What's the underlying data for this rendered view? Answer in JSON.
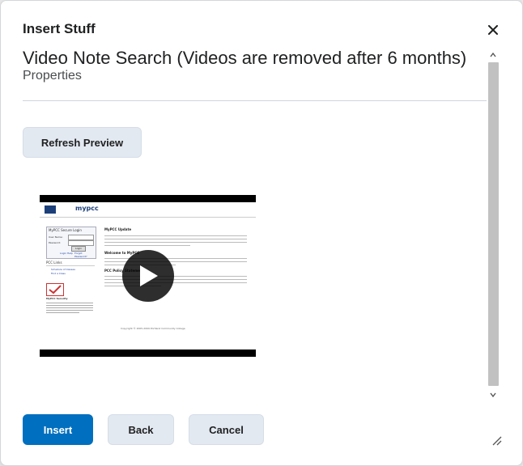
{
  "dialog": {
    "title": "Insert Stuff",
    "close_icon": "close-icon"
  },
  "content": {
    "heading": "Video Note Search (Videos are removed after 6 months)",
    "subheading": "Properties",
    "refresh_label": "Refresh Preview"
  },
  "video": {
    "thumbnail": {
      "logo_text": "mypcc",
      "login_title": "MyPCC Secure Login",
      "user_label": "User Name:",
      "pass_label": "Password:",
      "login_button": "Login",
      "help_links": [
        "Login Help",
        "Forgot Password?"
      ],
      "pcc_links_title": "PCC Links",
      "pcc_links": [
        "Schedule of Classes",
        "Find a Class"
      ],
      "update_title": "MyPCC Update",
      "welcome_title": "Welcome to MyPCC",
      "policy_title": "PCC Policy Statement",
      "security_title": "MyPCC Security",
      "footer": "Copyright © 2005-2009 Portland Community College"
    },
    "play_icon": "play-icon"
  },
  "footer": {
    "insert_label": "Insert",
    "back_label": "Back",
    "cancel_label": "Cancel"
  },
  "colors": {
    "primary": "#006fbf",
    "secondary": "#e3e9f1",
    "divider": "#cdd5dc"
  }
}
